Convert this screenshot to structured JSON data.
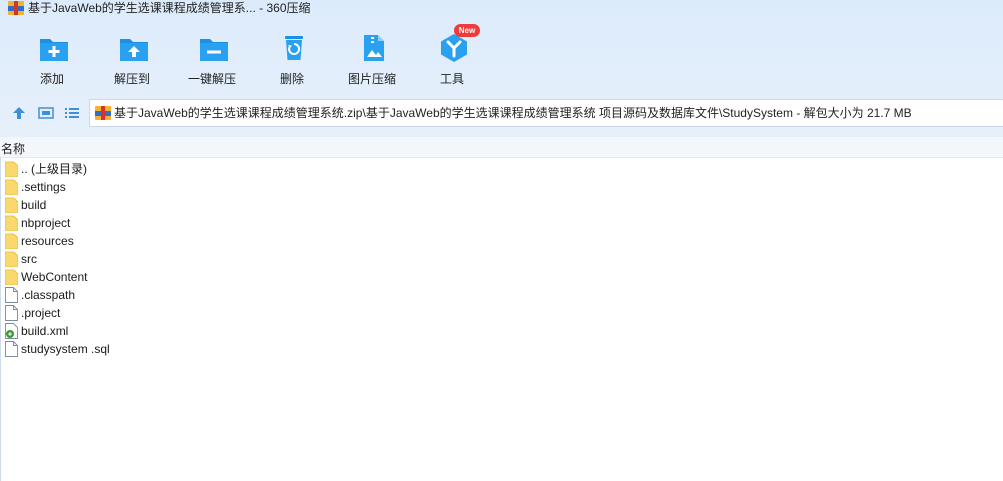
{
  "window": {
    "title": "基于JavaWeb的学生选课课程成绩管理系... - 360压缩"
  },
  "toolbar": {
    "tools": [
      {
        "label": "添加",
        "icon": "add-folder-icon"
      },
      {
        "label": "解压到",
        "icon": "extract-to-icon"
      },
      {
        "label": "一键解压",
        "icon": "one-click-extract-icon"
      },
      {
        "label": "删除",
        "icon": "recycle-delete-icon"
      },
      {
        "label": "图片压缩",
        "icon": "image-compress-icon"
      },
      {
        "label": "工具",
        "icon": "tools-icon"
      }
    ],
    "badge": "New"
  },
  "address": {
    "path": "基于JavaWeb的学生选课课程成绩管理系统.zip\\基于JavaWeb的学生选课课程成绩管理系统 项目源码及数据库文件\\StudySystem - 解包大小为 21.7 MB"
  },
  "list": {
    "column_name": "名称",
    "items": [
      {
        "name": ".. (上级目录)",
        "type": "folder"
      },
      {
        "name": ".settings",
        "type": "folder"
      },
      {
        "name": "build",
        "type": "folder"
      },
      {
        "name": "nbproject",
        "type": "folder"
      },
      {
        "name": "resources",
        "type": "folder"
      },
      {
        "name": "src",
        "type": "folder"
      },
      {
        "name": "WebContent",
        "type": "folder"
      },
      {
        "name": ".classpath",
        "type": "file"
      },
      {
        "name": ".project",
        "type": "file"
      },
      {
        "name": "build.xml",
        "type": "xml"
      },
      {
        "name": "studysystem .sql",
        "type": "file"
      }
    ]
  },
  "colors": {
    "toolbar_bg": "#dcebfb",
    "icon_blue": "#1e8fe6",
    "folder_yellow": "#fbd86b",
    "badge_red": "#ee3b3b"
  }
}
